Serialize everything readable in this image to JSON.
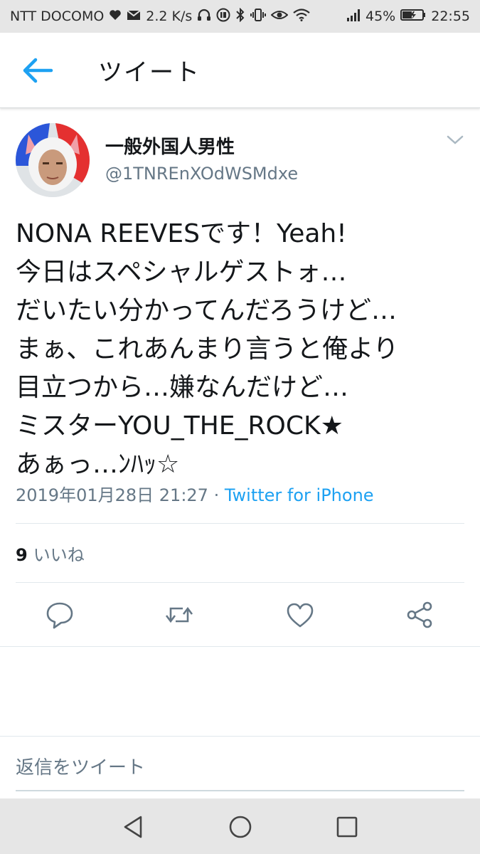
{
  "status_bar": {
    "carrier": "NTT DOCOMO",
    "speed": "2.2 K/s",
    "battery": "45%",
    "time": "22:55",
    "icons": [
      "heart-icon",
      "mail-icon",
      "headphones-icon",
      "volte-icon",
      "bluetooth-icon",
      "vibrate-icon",
      "eye-icon",
      "wifi-icon",
      "signal-icon",
      "battery-icon"
    ]
  },
  "app_bar": {
    "title": "ツイート",
    "back_icon": "arrow-left-icon",
    "accent_color": "#1da1f2"
  },
  "tweet": {
    "author_name": "一般外国人男性",
    "author_handle": "@1TNREnXOdWSMdxe",
    "lines": [
      "NONA REEVESです！Yeah!",
      "今日はスペシャルゲストォ…",
      "だいたい分かってんだろうけど…",
      "まぁ、これあんまり言うと俺より",
      "目立つから…嫌なんだけど…",
      "ミスターYOU_THE_ROCK★",
      "あぁっ…ﾝﾊｯ☆"
    ],
    "timestamp": "2019年01月28日 21:27",
    "separator": " · ",
    "source": "Twitter for iPhone",
    "likes_count": "9",
    "likes_label": "いいね"
  },
  "actions": [
    "reply-icon",
    "retweet-icon",
    "like-icon",
    "share-icon"
  ],
  "reply": {
    "placeholder": "返信をツイート"
  },
  "nav": [
    "back-triangle-icon",
    "home-circle-icon",
    "recents-square-icon"
  ]
}
